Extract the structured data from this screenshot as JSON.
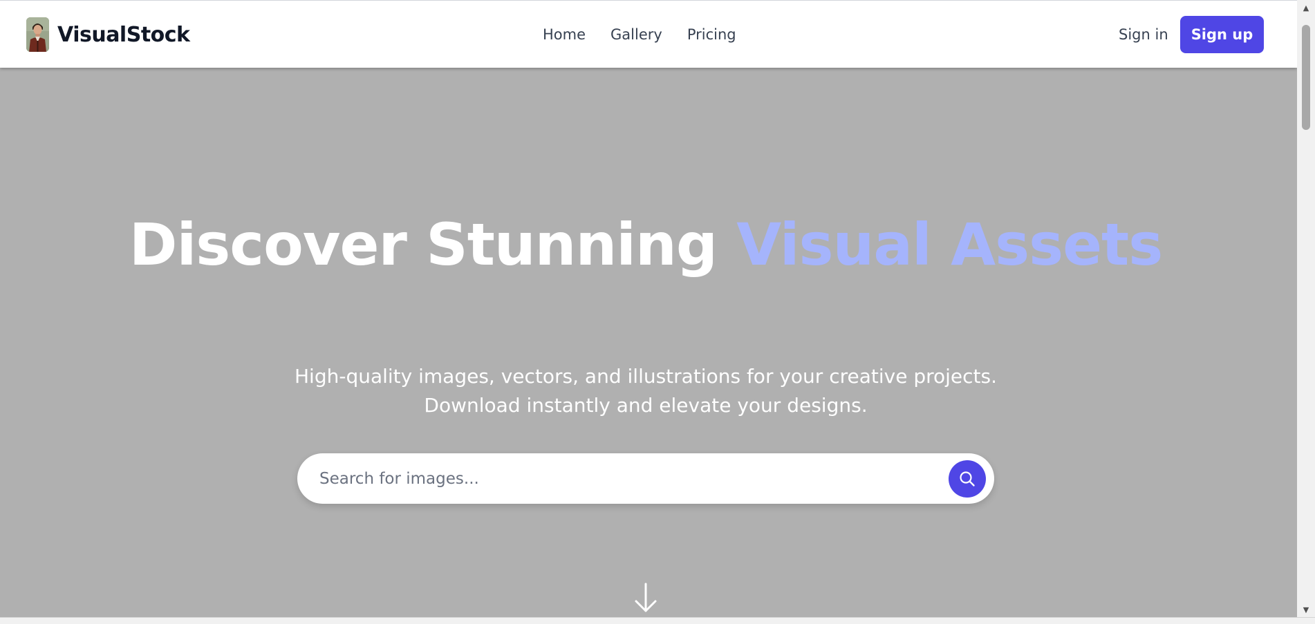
{
  "header": {
    "brand_name": "VisualStock",
    "logo_icon": "portrait-logo-icon",
    "nav": [
      "Home",
      "Gallery",
      "Pricing"
    ],
    "signin_label": "Sign in",
    "signup_label": "Sign up"
  },
  "hero": {
    "title_main": "Discover Stunning ",
    "title_accent": "Visual Assets",
    "subtitle_line1": "High-quality images, vectors, and illustrations for your creative projects.",
    "subtitle_line2": "Download instantly and elevate your designs.",
    "search_placeholder": "Search for images...",
    "search_icon": "search-icon",
    "scroll_icon": "arrow-down-icon"
  },
  "colors": {
    "brand": "#4f46e5",
    "accent": "#a5b4fc",
    "hero_bg": "#b0b0b0"
  }
}
